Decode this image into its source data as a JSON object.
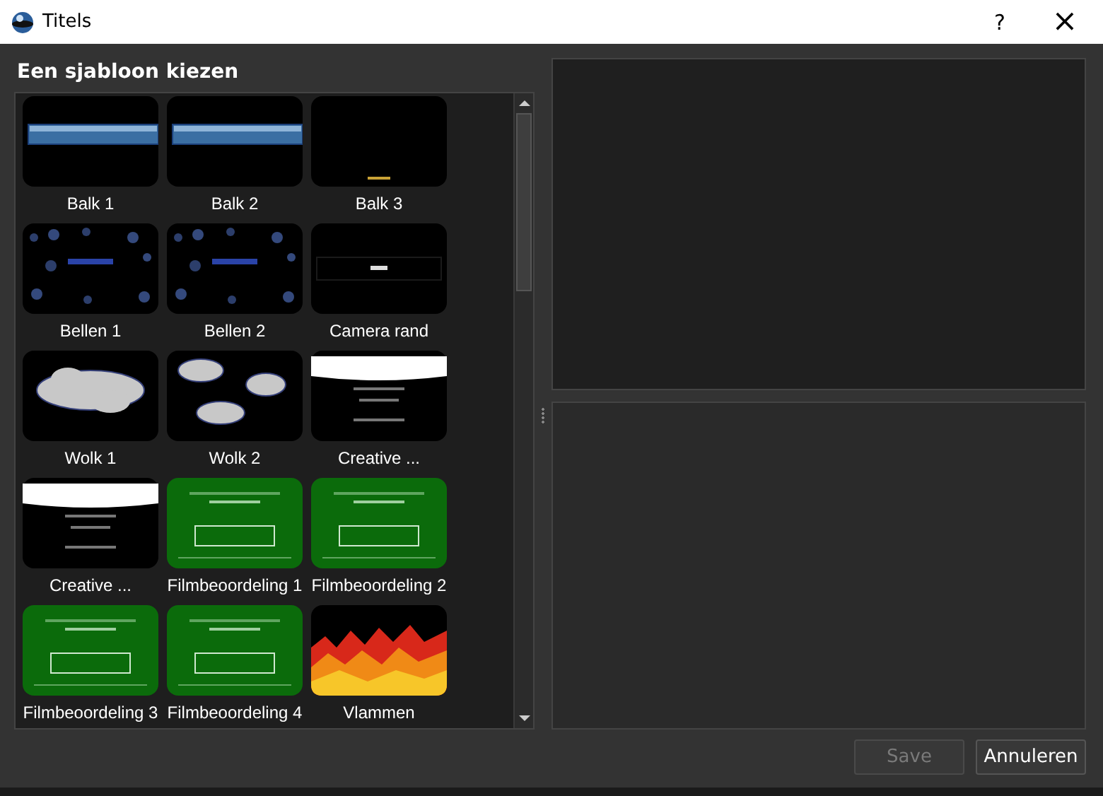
{
  "window": {
    "title": "Titels",
    "help": "?",
    "close": "×"
  },
  "heading": "Een sjabloon kiezen",
  "templates": [
    {
      "label": "Balk 1",
      "kind": "bar",
      "selected": false
    },
    {
      "label": "Balk 2",
      "kind": "bar",
      "selected": false
    },
    {
      "label": "Balk 3",
      "kind": "plain",
      "selected": false
    },
    {
      "label": "Bellen 1",
      "kind": "bubbles",
      "selected": false
    },
    {
      "label": "Bellen 2",
      "kind": "bubbles",
      "selected": false
    },
    {
      "label": "Camera rand",
      "kind": "frame",
      "selected": false
    },
    {
      "label": "Wolk 1",
      "kind": "cloud",
      "selected": false
    },
    {
      "label": "Wolk 2",
      "kind": "clouds",
      "selected": false
    },
    {
      "label": "Creative ...",
      "kind": "license",
      "selected": false
    },
    {
      "label": "Creative ...",
      "kind": "license",
      "selected": false
    },
    {
      "label": "Filmbeoordeling 1",
      "kind": "rating",
      "selected": false
    },
    {
      "label": "Filmbeoordeling 2",
      "kind": "rating",
      "selected": false
    },
    {
      "label": "Filmbeoordeling 3",
      "kind": "rating",
      "selected": false
    },
    {
      "label": "Filmbeoordeling 4",
      "kind": "rating",
      "selected": false
    },
    {
      "label": "Vlammen",
      "kind": "flames",
      "selected": false
    }
  ],
  "buttons": [
    {
      "label": "Save",
      "disabled": true
    },
    {
      "label": "Annuleren",
      "disabled": false
    }
  ]
}
